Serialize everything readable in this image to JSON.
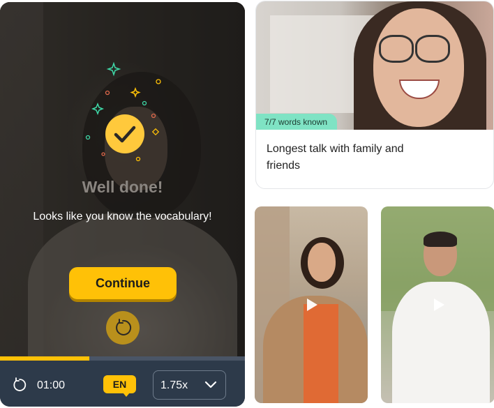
{
  "player": {
    "completion": {
      "title": "Well done!",
      "message": "Looks like you know the vocabulary!",
      "continue_label": "Continue"
    },
    "progress_fraction": 0.365,
    "time": "01:00",
    "language": "EN",
    "speed": "1.75x",
    "icons": {
      "check": "checkmark-icon",
      "replay": "replay-icon",
      "rewind": "rewind-icon",
      "speed_dropdown": "chevron-down-icon"
    }
  },
  "card": {
    "badge": "7/7 words known",
    "title": "Longest talk with family and friends"
  },
  "thumbnails": [
    {
      "icon": "play-icon"
    },
    {
      "icon": "play-icon"
    }
  ],
  "colors": {
    "accent": "#ffc107",
    "badge_green": "#7fe3c4",
    "control_bar": "#2d3a4a"
  }
}
